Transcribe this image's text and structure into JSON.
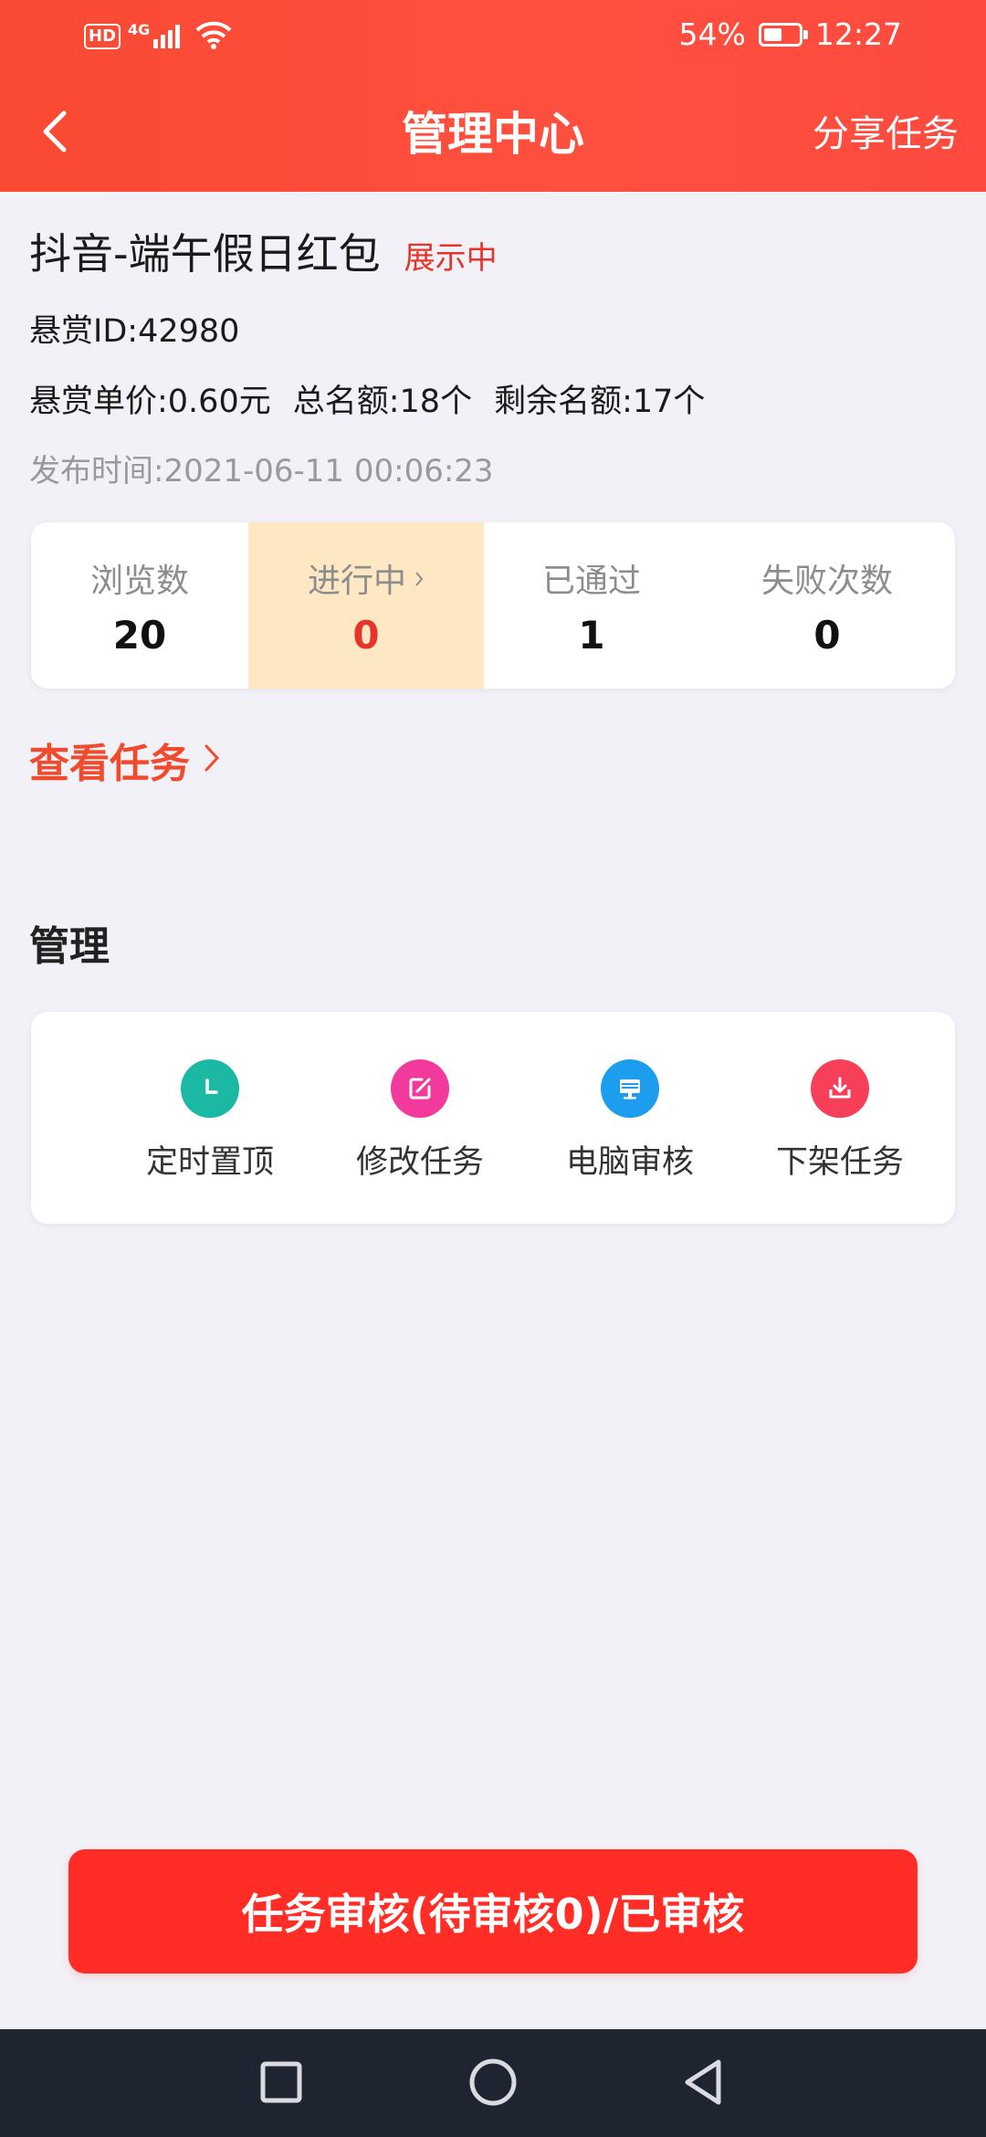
{
  "status_bar": {
    "hd": "HD",
    "network": "4G",
    "battery_percent": "54%",
    "battery_level": 0.54,
    "time": "12:27"
  },
  "nav": {
    "title": "管理中心",
    "share": "分享任务",
    "icons": {
      "back": "chevron-left-icon"
    }
  },
  "task": {
    "title": "抖音-端午假日红包",
    "status": "展示中",
    "reward_id": "悬赏ID:42980",
    "unit_price": "悬赏单价:0.60元",
    "total_quota": "总名额:18个",
    "remaining_quota": "剩余名额:17个",
    "publish_time": "发布时间:2021-06-11 00:06:23"
  },
  "stats": [
    {
      "label": "浏览数",
      "value": "20"
    },
    {
      "label": "进行中",
      "value": "0"
    },
    {
      "label": "已通过",
      "value": "1"
    },
    {
      "label": "失败次数",
      "value": "0"
    }
  ],
  "view_tasks": "查看任务",
  "manage": {
    "title": "管理",
    "items": [
      {
        "label": "定时置顶",
        "icon": "clock-icon",
        "color": "#1bb8a4"
      },
      {
        "label": "修改任务",
        "icon": "edit-icon",
        "color": "#f2399c"
      },
      {
        "label": "电脑审核",
        "icon": "computer-icon",
        "color": "#1d9ded"
      },
      {
        "label": "下架任务",
        "icon": "download-icon",
        "color": "#f6405a"
      }
    ]
  },
  "review_button": "任务审核(待审核0)/已审核",
  "colors": {
    "header": "#fe4a3f",
    "accent_red": "#e8332a",
    "highlight": "#fde8c3",
    "button": "#ff2d26",
    "system_nav": "#1f2431"
  }
}
